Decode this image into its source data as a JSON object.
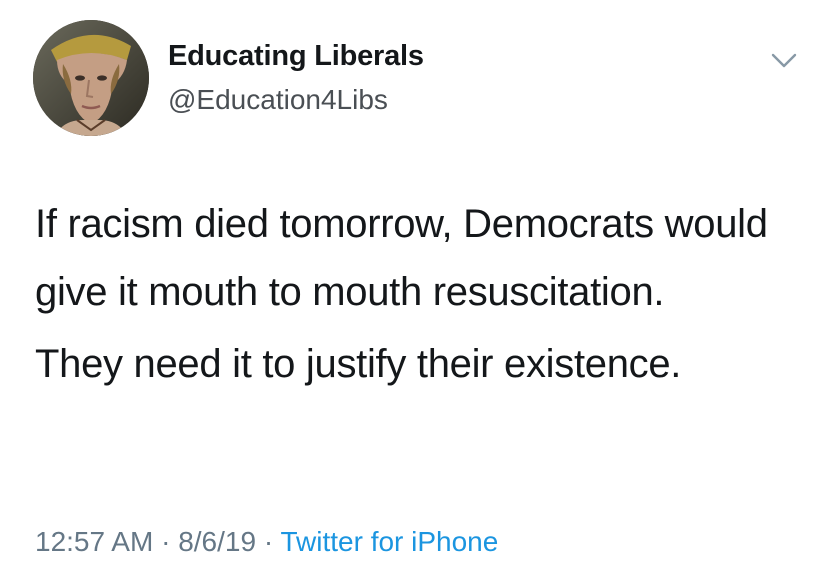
{
  "author": {
    "display_name": "Educating Liberals",
    "handle": "@Education4Libs"
  },
  "tweet": {
    "paragraphs": [
      "If racism died tomorrow, Democrats would give it mouth to mouth resuscitation.",
      "They need it to justify their existence."
    ]
  },
  "meta": {
    "time": "12:57 AM",
    "separator": " · ",
    "date": "8/6/19",
    "source": "Twitter for iPhone"
  },
  "icons": {
    "menu": "chevron-down-icon",
    "avatar": "profile-photo"
  },
  "colors": {
    "text": "#14171a",
    "secondary": "#657786",
    "link": "#1b95e0"
  }
}
